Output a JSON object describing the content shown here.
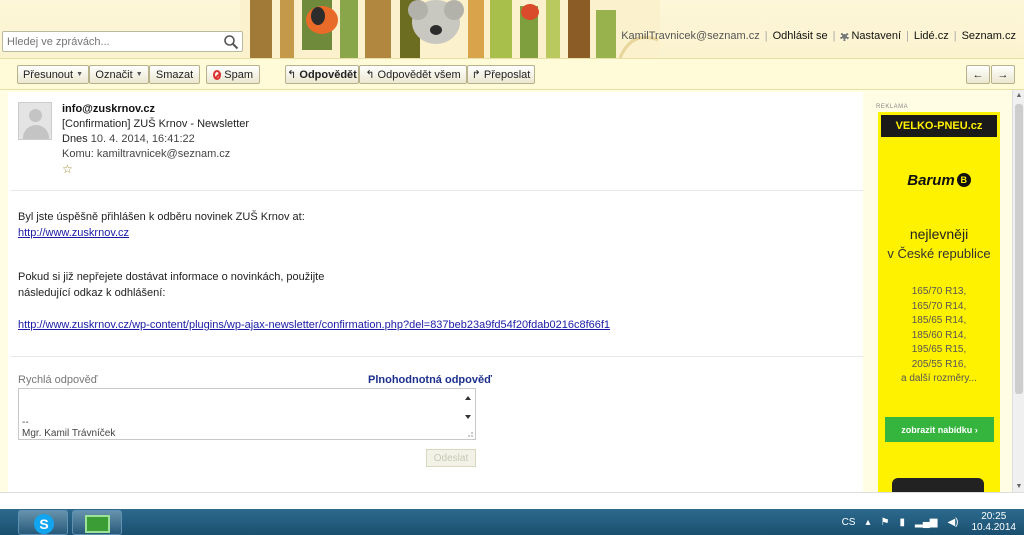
{
  "header": {
    "search_placeholder": "Hledej ve zprávách...",
    "user_email": "KamilTravnicek@seznam.cz",
    "logout": "Odhlásit se",
    "settings": "Nastavení",
    "people": "Lidé.cz",
    "seznam": "Seznam.cz"
  },
  "toolbar": {
    "move": "Přesunout",
    "mark": "Označit",
    "delete": "Smazat",
    "spam": "Spam",
    "reply": "Odpovědět",
    "reply_all": "Odpovědět všem",
    "forward": "Přeposlat",
    "prev": "←",
    "next": "→"
  },
  "message": {
    "from": "info@zuskrnov.cz",
    "subject": "[Confirmation] ZUŠ Krnov - Newsletter",
    "date_prefix": "Dnes",
    "date": "10. 4. 2014, 16:41:22",
    "to_label": "Komu:",
    "to": "kamiltravnicek@seznam.cz",
    "star": "☆",
    "line1": "Byl jste úspěšně přihlášen k odběru novinek ZUŠ Krnov at:",
    "link1": "http://www.zuskrnov.cz",
    "line2": "Pokud si již nepřejete dostávat informace o novinkách, použijte",
    "line3": "následující odkaz k odhlášení:",
    "link2": "http://www.zuskrnov.cz/wp-content/plugins/wp-ajax-newsletter/confirmation.php?del=837beb23a9fd54f20fdab0216c8f66f1"
  },
  "quick_reply": {
    "label": "Rychlá odpověď",
    "full_reply": "Plnohodnotná odpověď",
    "signature_dash": "--",
    "signature_name": "Mgr. Kamil Trávníček",
    "send": "Odeslat"
  },
  "ad": {
    "label": "REKLAMA",
    "brand": "VELKO-PNEU.cz",
    "barum": "Barum",
    "barum_mark": "B",
    "cheapest": "nejlevněji",
    "country": "v České republice",
    "sizes": [
      "165/70 R13,",
      "165/70 R14,",
      "185/65 R14,",
      "185/60 R14,",
      "195/65 R15,",
      "205/55 R16,",
      "a další rozměry..."
    ],
    "cta": "zobrazit nabídku ›"
  },
  "taskbar": {
    "lang": "CS",
    "time": "20:25",
    "date": "10.4.2014",
    "skype_letter": "S"
  },
  "colors": {
    "background": "#fffde4",
    "link": "#1a1aa6",
    "ad_yellow": "#fff200",
    "cta_green": "#35b53e",
    "taskbar": "#1b4f70"
  }
}
